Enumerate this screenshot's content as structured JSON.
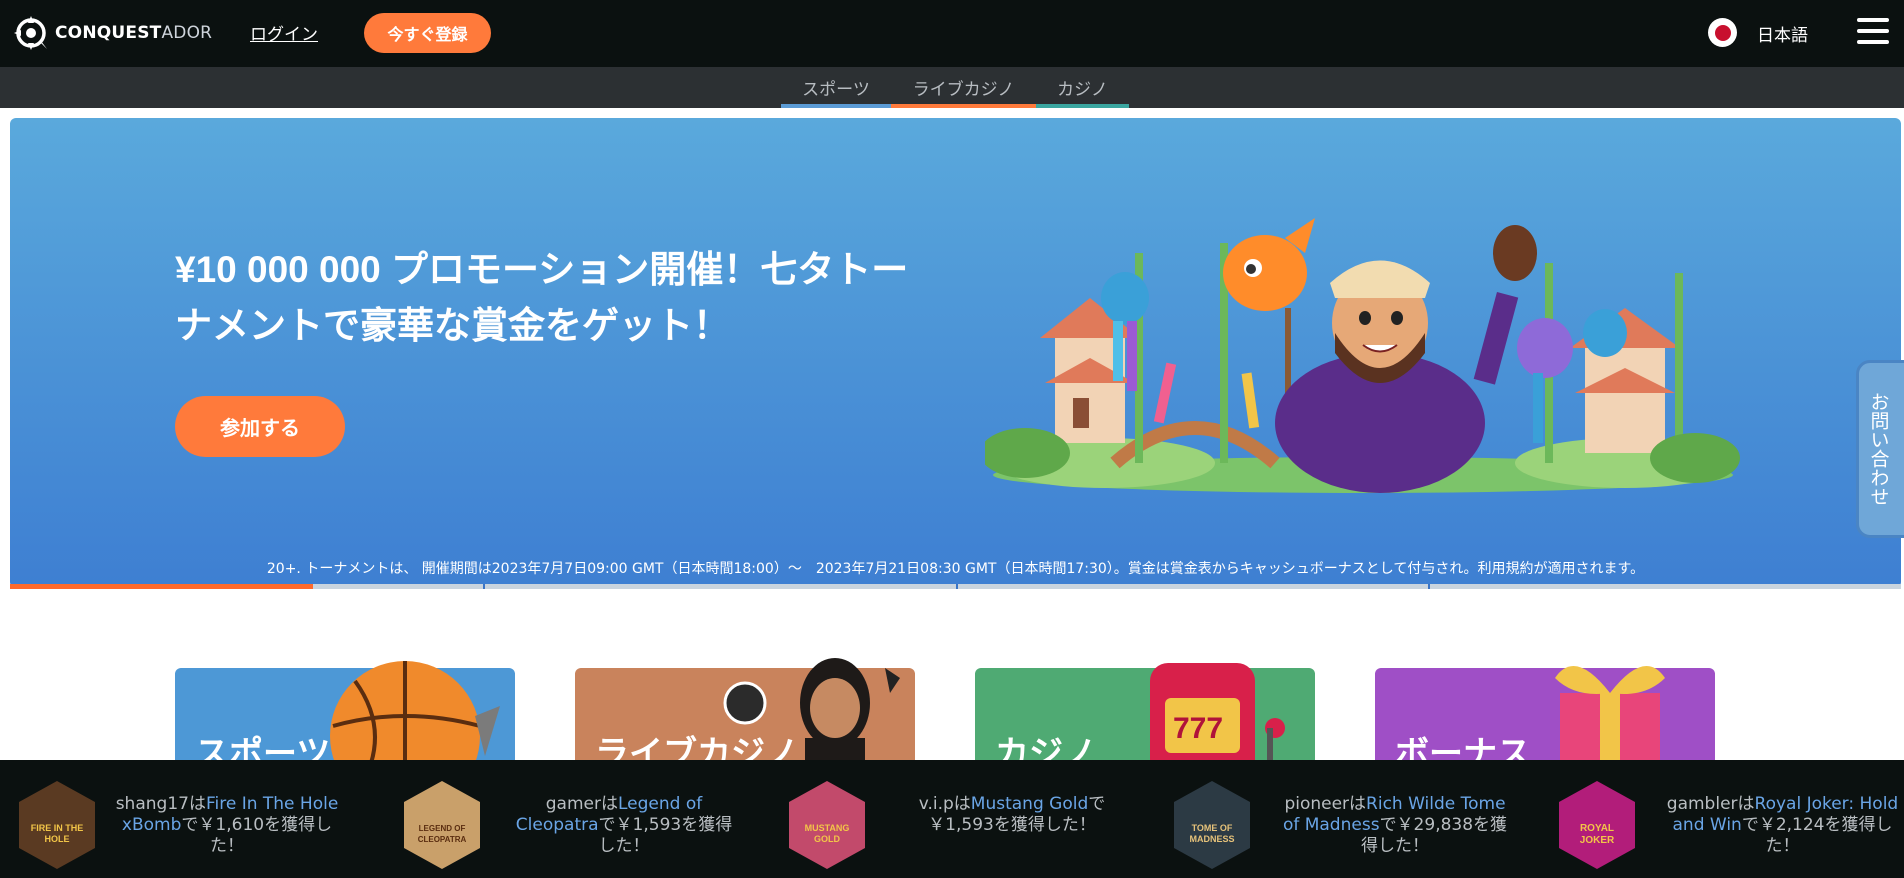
{
  "header": {
    "logo": {
      "primary": "CONQUEST",
      "secondary": "ADOR"
    },
    "login_label": "ログイン",
    "register_label": "今すぐ登録",
    "language_label": "日本語"
  },
  "subnav": {
    "items": [
      {
        "label": "スポーツ",
        "color": "#5b9bd5"
      },
      {
        "label": "ライブカジノ",
        "color": "#ff7a3b"
      },
      {
        "label": "カジノ",
        "color": "#3aa6a0"
      }
    ]
  },
  "hero": {
    "title": "¥10 000 000 プロモーション開催！七タトーナメントで豪華な賞金をゲット！",
    "cta_label": "参加する",
    "disclaimer": "20+. トーナメントは、 開催期間は2023年7月7日09:00 GMT（日本時間18:00）～　2023年7月21日08:30 GMT（日本時間17:30）。賞金は賞金表からキャッシュボーナスとして付与され。利用規約が適用されます。",
    "slide_progress": 0.16,
    "slide_count": 4
  },
  "contact_tab": {
    "label": "お問い合わせ"
  },
  "categories": [
    {
      "label": "スポーツ",
      "color": "#4d98d6"
    },
    {
      "label": "ライブカジノ",
      "color": "#c9835c"
    },
    {
      "label": "カジノ",
      "color": "#4faa73"
    },
    {
      "label": "ボーナス",
      "color": "#9f4fc6"
    }
  ],
  "winners": [
    {
      "user": "shang17",
      "game": "Fire In The Hole xBomb",
      "prefix": "は",
      "suffix": "で￥1,610を獲得した！",
      "thumb_color": "#5a3a22",
      "thumb_label": "FIRE IN THE HOLE"
    },
    {
      "user": "gamer",
      "game": "Legend of Cleopatra",
      "prefix": "は",
      "suffix": "で￥1,593を獲得した！",
      "thumb_color": "#c9a06a",
      "thumb_label": "LEGEND OF CLEOPATRA"
    },
    {
      "user": "v.i.p",
      "game": "Mustang Gold",
      "prefix": "は",
      "suffix": "で￥1,593を獲得した！",
      "thumb_color": "#c24a6b",
      "thumb_label": "MUSTANG GOLD"
    },
    {
      "user": "pioneer",
      "game": "Rich Wilde Tome of Madness",
      "prefix": "は",
      "suffix": "で￥29,838を獲得した！",
      "thumb_color": "#2c3a44",
      "thumb_label": "TOME OF MADNESS"
    },
    {
      "user": "gambler",
      "game": "Royal Joker: Hold and Win",
      "prefix": "は",
      "suffix": "で￥2,124を獲得した！",
      "thumb_color": "#b21d7a",
      "thumb_label": "ROYAL JOKER"
    }
  ]
}
